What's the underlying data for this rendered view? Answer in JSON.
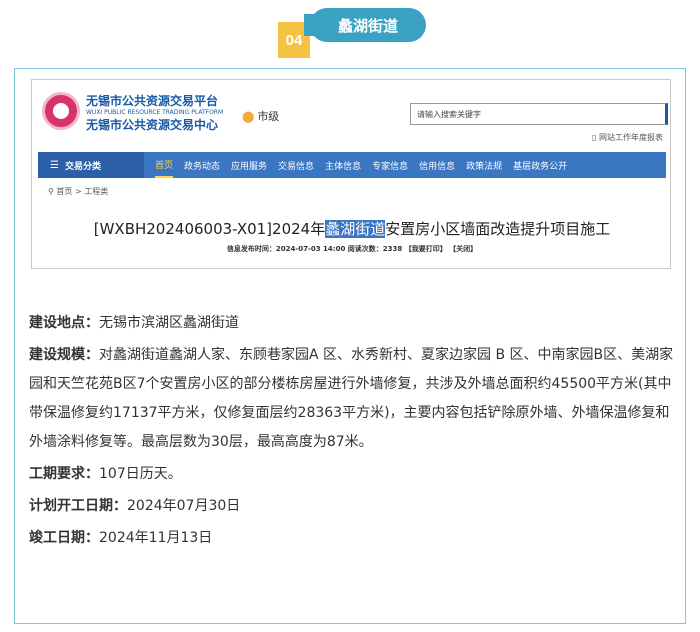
{
  "header": {
    "number": "04",
    "title": "蠡湖街道"
  },
  "screenshot": {
    "brand_line1": "无锡市公共资源交易平台",
    "brand_en": "WUXI PUBLIC RESOURCE TRADING PLATFORM",
    "brand_line2": "无锡市公共资源交易中心",
    "location": "市级",
    "search_placeholder": "请输入搜索关键字",
    "manual_link": "网站工作年度报表",
    "nav": {
      "category": "交易分类",
      "items": [
        "首页",
        "政务动态",
        "应用服务",
        "交易信息",
        "主体信息",
        "专家信息",
        "信用信息",
        "政策法规",
        "基层政务公开"
      ]
    },
    "breadcrumb": "首页 > 工程类",
    "title_prefix": "[WXBH202406003-X01]2024年",
    "title_highlight": "蠡湖街道",
    "title_suffix": "安置房小区墙面改造提升项目施工",
    "meta": "信息发布时间：2024-07-03 14:00    阅读次数：2338  【我要打印】  【关闭】"
  },
  "details": {
    "location_label": "建设地点：",
    "location_value": "无锡市滨湖区蠡湖街道",
    "scale_label": "建设规模：",
    "scale_value": "对蠡湖街道蠡湖人家、东顾巷家园A 区、水秀新村、夏家边家园 B 区、中南家园B区、美湖家园和天竺花苑B区7个安置房小区的部分楼栋房屋进行外墙修复，共涉及外墙总面积约45500平方米(其中带保温修复约17137平方米，仅修复面层约28363平方米)，主要内容包括铲除原外墙、外墙保温修复和外墙涂料修复等。最高层数为30层，最高高度为87米。",
    "period_label": "工期要求：",
    "period_value": "107日历天。",
    "start_label": "计划开工日期：",
    "start_value": "2024年07月30日",
    "end_label": "竣工日期：",
    "end_value": "2024年11月13日"
  }
}
